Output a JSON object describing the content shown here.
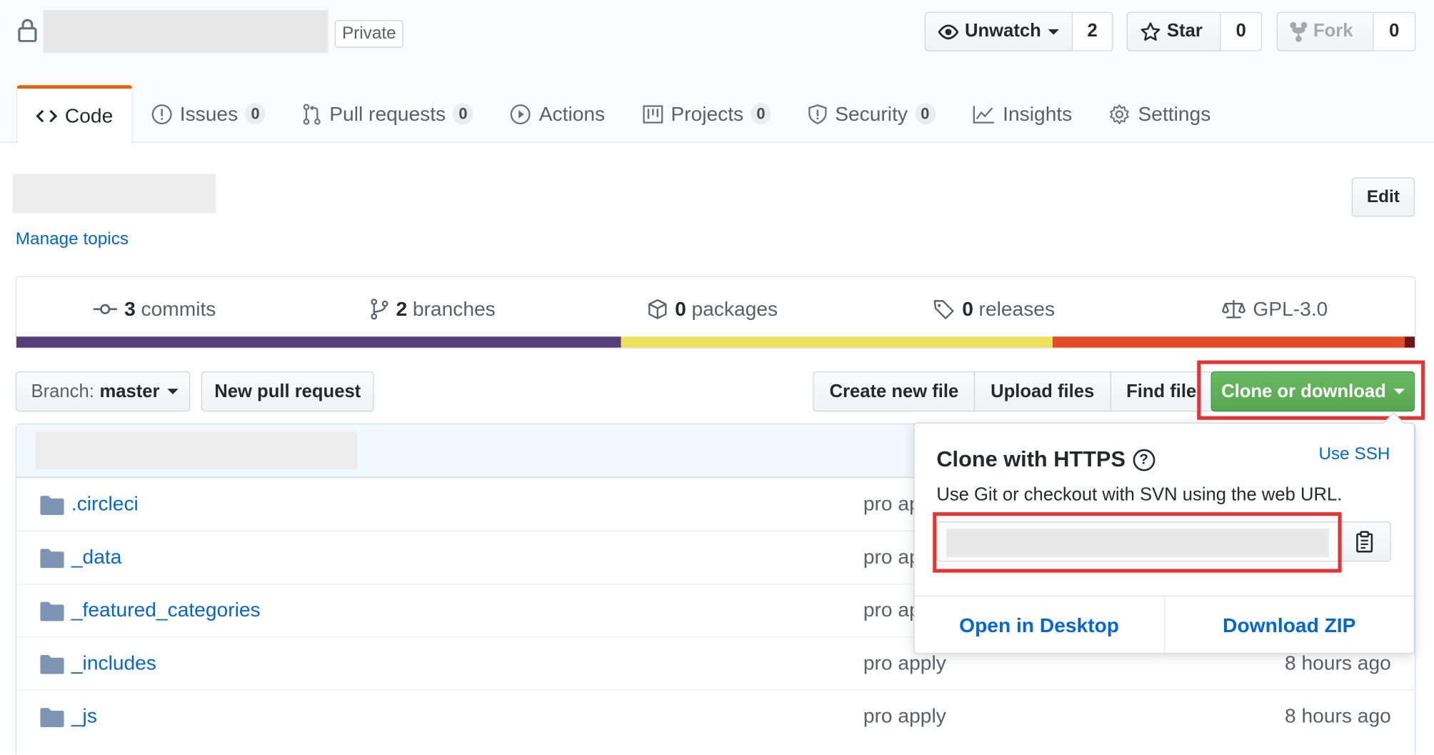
{
  "repo": {
    "visibility_label": "Private"
  },
  "actions": {
    "watch": {
      "label": "Unwatch",
      "count": "2"
    },
    "star": {
      "label": "Star",
      "count": "0"
    },
    "fork": {
      "label": "Fork",
      "count": "0"
    }
  },
  "tabs": [
    {
      "label": "Code",
      "counter": null,
      "icon": "code-icon",
      "selected": true
    },
    {
      "label": "Issues",
      "counter": "0",
      "icon": "issue-icon"
    },
    {
      "label": "Pull requests",
      "counter": "0",
      "icon": "pull-request-icon"
    },
    {
      "label": "Actions",
      "counter": null,
      "icon": "play-icon"
    },
    {
      "label": "Projects",
      "counter": "0",
      "icon": "project-icon"
    },
    {
      "label": "Security",
      "counter": "0",
      "icon": "shield-icon"
    },
    {
      "label": "Insights",
      "counter": null,
      "icon": "graph-icon"
    },
    {
      "label": "Settings",
      "counter": null,
      "icon": "gear-icon"
    }
  ],
  "description": {
    "manage_topics": "Manage topics",
    "edit_label": "Edit"
  },
  "summary": {
    "commits": {
      "count": "3",
      "label": "commits"
    },
    "branches": {
      "count": "2",
      "label": "branches"
    },
    "packages": {
      "count": "0",
      "label": "packages"
    },
    "releases": {
      "count": "0",
      "label": "releases"
    },
    "license": "GPL-3.0"
  },
  "language_bar": [
    {
      "color": "#563d7c",
      "share": 43.2
    },
    {
      "color": "#f1e05a",
      "share": 30.9
    },
    {
      "color": "#e34c26",
      "share": 25.2
    },
    {
      "color": "#701516",
      "share": 0.7
    }
  ],
  "file_nav": {
    "branch_prefix": "Branch:",
    "branch_name": "master",
    "new_pull_request": "New pull request",
    "create_new_file": "Create new file",
    "upload_files": "Upload files",
    "find_file": "Find file",
    "clone_or_download": "Clone or download"
  },
  "files": [
    {
      "name": ".circleci",
      "message": "pro apply",
      "age": ""
    },
    {
      "name": "_data",
      "message": "pro apply",
      "age": ""
    },
    {
      "name": "_featured_categories",
      "message": "pro apply",
      "age": ""
    },
    {
      "name": "_includes",
      "message": "pro apply",
      "age": "8 hours ago"
    },
    {
      "name": "_js",
      "message": "pro apply",
      "age": "8 hours ago"
    }
  ],
  "clone_dropdown": {
    "title": "Clone with HTTPS",
    "help_glyph": "?",
    "use_ssh": "Use SSH",
    "description": "Use Git or checkout with SVN using the web URL.",
    "open_in_desktop": "Open in Desktop",
    "download_zip": "Download ZIP"
  },
  "colors": {
    "accent_tab": "#e36209",
    "link": "#0366d6",
    "clone_button": "#5aa653",
    "highlight": "#e63333"
  }
}
